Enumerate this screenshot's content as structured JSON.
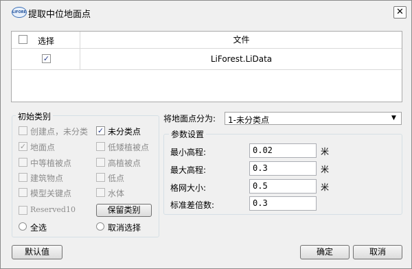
{
  "window": {
    "title": "提取中位地面点",
    "logo_text": "LIFOREST"
  },
  "file_table": {
    "headers": {
      "select": "选择",
      "file": "文件"
    },
    "rows": [
      {
        "file": "LiForest.LiData",
        "checked": true
      }
    ]
  },
  "initial_classes": {
    "title": "初始类别",
    "items": [
      {
        "label": "创建点，未分类",
        "checked": false,
        "enabled": false
      },
      {
        "label": "未分类点",
        "checked": true,
        "enabled": true
      },
      {
        "label": "地面点",
        "checked": true,
        "enabled": false
      },
      {
        "label": "低矮植被点",
        "checked": false,
        "enabled": false
      },
      {
        "label": "中等植被点",
        "checked": false,
        "enabled": false
      },
      {
        "label": "高植被点",
        "checked": false,
        "enabled": false
      },
      {
        "label": "建筑物点",
        "checked": false,
        "enabled": false
      },
      {
        "label": "低点",
        "checked": false,
        "enabled": false
      },
      {
        "label": "模型关键点",
        "checked": false,
        "enabled": false
      },
      {
        "label": "水体",
        "checked": false,
        "enabled": false
      },
      {
        "label": "Reserved10",
        "checked": false,
        "enabled": false
      }
    ],
    "keep_class_button": "保留类别",
    "select_all": "全选",
    "deselect": "取消选择"
  },
  "ground_class": {
    "label": "将地面点分为:",
    "value": "1-未分类点"
  },
  "params": {
    "title": "参数设置",
    "fields": [
      {
        "label": "最小高程:",
        "value": "0.02",
        "unit": "米"
      },
      {
        "label": "最大高程:",
        "value": "0.3",
        "unit": "米"
      },
      {
        "label": "格网大小:",
        "value": "0.5",
        "unit": "米"
      },
      {
        "label": "标准差倍数:",
        "value": "0.3",
        "unit": ""
      }
    ]
  },
  "footer": {
    "default_button": "默认值",
    "ok_button": "确定",
    "cancel_button": "取消"
  }
}
